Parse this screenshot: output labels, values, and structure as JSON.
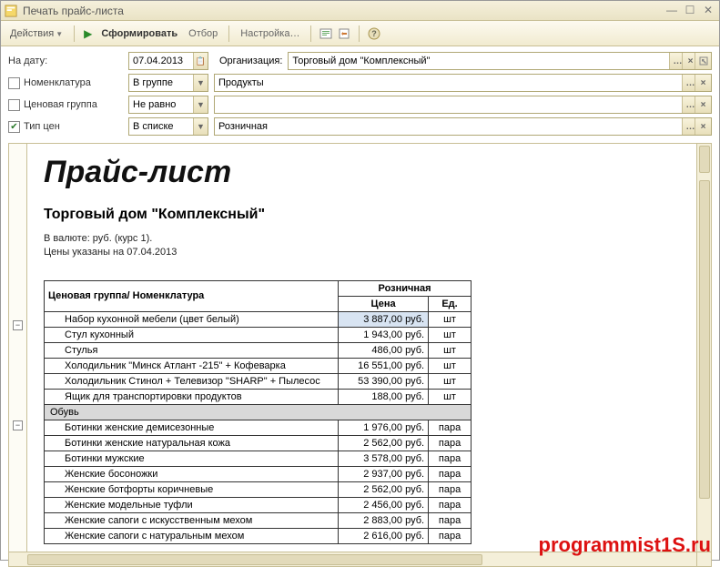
{
  "window": {
    "title": "Печать прайс-листа"
  },
  "toolbar": {
    "actions": "Действия",
    "form": "Сформировать",
    "filter": "Отбор",
    "settings": "Настройка…"
  },
  "filters": {
    "date_label": "На дату:",
    "date_value": "07.04.2013",
    "org_label": "Организация:",
    "org_value": "Торговый дом \"Комплексный\"",
    "nomen_label": "Номенклатура",
    "nomen_op": "В группе",
    "nomen_val": "Продукты",
    "pricegrp_label": "Ценовая группа",
    "pricegrp_op": "Не равно",
    "pricegrp_val": "",
    "pricetype_label": "Тип цен",
    "pricetype_checked": true,
    "pricetype_op": "В списке",
    "pricetype_val": "Розничная"
  },
  "doc": {
    "title": "Прайс-лист",
    "subtitle": "Торговый дом \"Комплексный\"",
    "meta1": "В валюте: руб. (курс 1).",
    "meta2": "Цены указаны на 07.04.2013",
    "col_group": "Ценовая группа/ Номенклатура",
    "col_pricegrp": "Розничная",
    "col_price": "Цена",
    "col_unit": "Ед.",
    "rows": [
      {
        "type": "item",
        "name": "Набор кухонной мебели (цвет белый)",
        "price": "3 887,00 руб.",
        "unit": "шт",
        "selected": true
      },
      {
        "type": "item",
        "name": "Стул кухонный",
        "price": "1 943,00 руб.",
        "unit": "шт"
      },
      {
        "type": "item",
        "name": "Стулья",
        "price": "486,00 руб.",
        "unit": "шт"
      },
      {
        "type": "item",
        "name": "Холодильник \"Минск Атлант -215\" + Кофеварка",
        "price": "16 551,00 руб.",
        "unit": "шт"
      },
      {
        "type": "item",
        "name": "Холодильник Стинол + Телевизор \"SHARP\" + Пылесос",
        "price": "53 390,00 руб.",
        "unit": "шт"
      },
      {
        "type": "item",
        "name": "Ящик для транспортировки продуктов",
        "price": "188,00 руб.",
        "unit": "шт"
      },
      {
        "type": "section",
        "name": "Обувь"
      },
      {
        "type": "item",
        "name": "Ботинки женские демисезонные",
        "price": "1 976,00 руб.",
        "unit": "пара"
      },
      {
        "type": "item",
        "name": "Ботинки женские натуральная кожа",
        "price": "2 562,00 руб.",
        "unit": "пара"
      },
      {
        "type": "item",
        "name": "Ботинки мужские",
        "price": "3 578,00 руб.",
        "unit": "пара"
      },
      {
        "type": "item",
        "name": "Женские босоножки",
        "price": "2 937,00 руб.",
        "unit": "пара"
      },
      {
        "type": "item",
        "name": "Женские ботфорты коричневые",
        "price": "2 562,00 руб.",
        "unit": "пара"
      },
      {
        "type": "item",
        "name": "Женские модельные туфли",
        "price": "2 456,00 руб.",
        "unit": "пара"
      },
      {
        "type": "item",
        "name": "Женские сапоги с искусственным мехом",
        "price": "2 883,00 руб.",
        "unit": "пара"
      },
      {
        "type": "item",
        "name": "Женские сапоги с натуральным мехом",
        "price": "2 616,00 руб.",
        "unit": "пара"
      }
    ]
  },
  "watermark": "programmist1S.ru"
}
